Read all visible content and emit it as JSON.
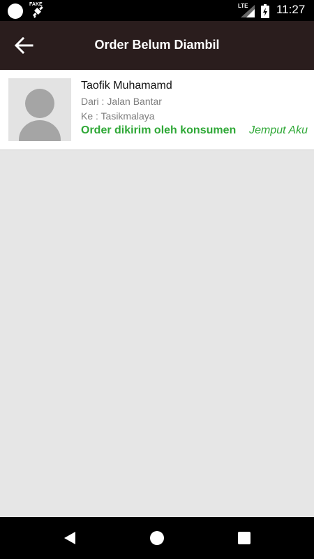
{
  "status_bar": {
    "fake_gps_label": "FAKE",
    "network": "LTE",
    "time": "11:27"
  },
  "toolbar": {
    "title": "Order Belum Diambil"
  },
  "orders": [
    {
      "name": "Taofik Muhamamd",
      "from": "Dari : Jalan Bantar",
      "to": "Ke : Tasikmalaya",
      "status_message": "Order dikirim oleh konsumen",
      "service_type": "Jemput Aku"
    }
  ],
  "colors": {
    "toolbar": "#2a1d1d",
    "status_green": "#2ea836",
    "background": "#e6e6e6"
  },
  "icons": {
    "back": "arrow-left-icon",
    "avatar": "default-avatar-icon",
    "nav_back": "triangle-back-icon",
    "nav_home": "circle-home-icon",
    "nav_recents": "square-recents-icon"
  }
}
